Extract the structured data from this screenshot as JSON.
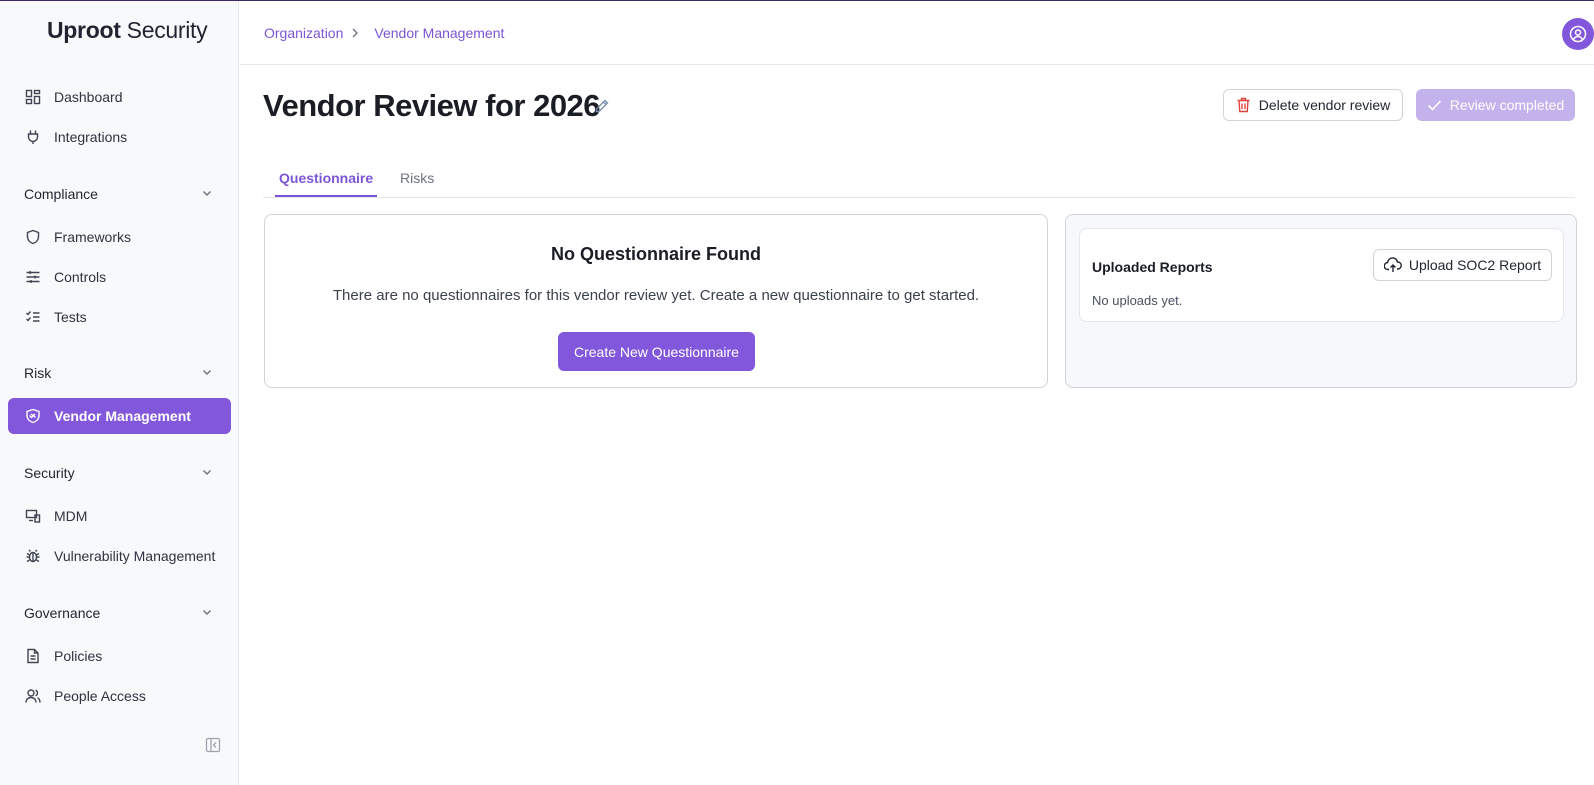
{
  "brand": {
    "name_bold": "Uproot",
    "name_rest": " Security"
  },
  "sidebar": {
    "dashboard": "Dashboard",
    "integrations": "Integrations",
    "sections": {
      "compliance": "Compliance",
      "risk": "Risk",
      "security": "Security",
      "governance": "Governance"
    },
    "frameworks": "Frameworks",
    "controls": "Controls",
    "tests": "Tests",
    "vendor_management": "Vendor Management",
    "mdm": "MDM",
    "vulnerability_management": "Vulnerability Management",
    "policies": "Policies",
    "people_access": "People Access",
    "active_item": "vendor_management",
    "icons": {
      "dashboard": "dashboard-grid-icon",
      "integrations": "plug-icon",
      "frameworks": "shield-icon",
      "controls": "sliders-icon",
      "tests": "checklist-icon",
      "vendor_management": "handshake-shield-icon",
      "mdm": "devices-icon",
      "vulnerability_management": "bug-icon",
      "policies": "document-icon",
      "people_access": "users-icon",
      "collapse": "sidebar-collapse-icon"
    }
  },
  "header": {
    "breadcrumb": [
      "Organization",
      "Vendor Management"
    ]
  },
  "page": {
    "title": "Vendor Review for 2026",
    "delete_label": "Delete vendor review",
    "completed_label": "Review completed"
  },
  "tabs": [
    "Questionnaire",
    "Risks"
  ],
  "questionnaire": {
    "heading": "No Questionnaire Found",
    "message": "There are no questionnaires for this vendor review yet. Create a new questionnaire to get started.",
    "create_label": "Create New Questionnaire"
  },
  "reports": {
    "title": "Uploaded Reports",
    "upload_label": "Upload SOC2 Report",
    "empty_text": "No uploads yet."
  },
  "colors": {
    "accent": "#8257dc",
    "accent_text": "#7c55d6",
    "disabled_accent": "#c4b2ec",
    "danger": "#e0433e"
  }
}
